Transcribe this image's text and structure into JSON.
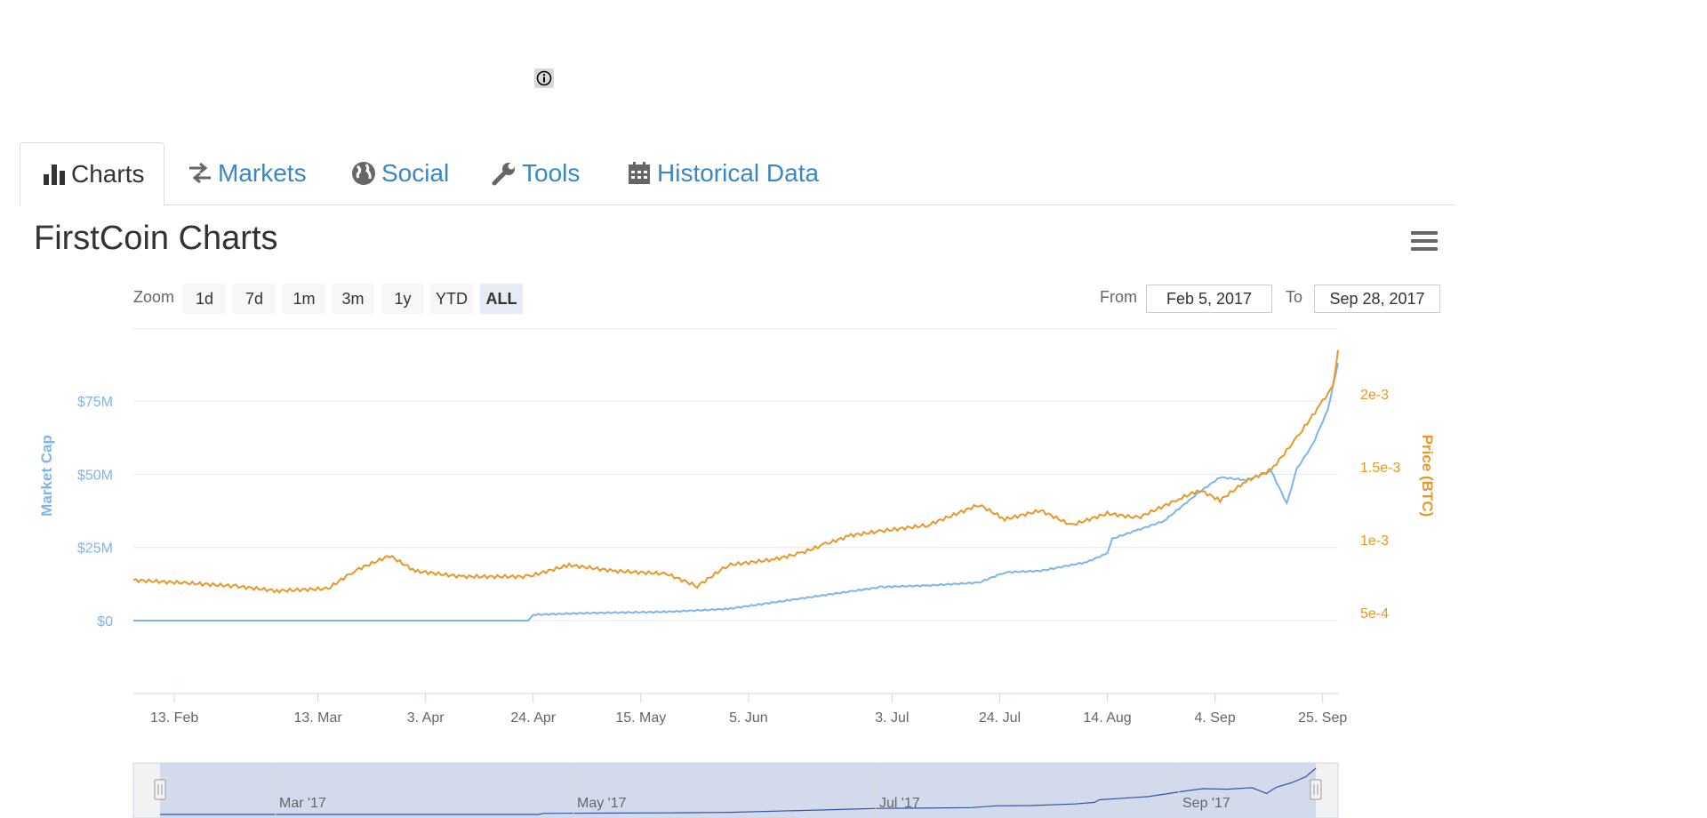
{
  "info_icon": "info-circle-icon",
  "tabs": [
    {
      "label": "Charts",
      "icon": "bar-chart-icon",
      "active": true
    },
    {
      "label": "Markets",
      "icon": "exchange-arrows-icon",
      "active": false
    },
    {
      "label": "Social",
      "icon": "globe-icon",
      "active": false
    },
    {
      "label": "Tools",
      "icon": "wrench-icon",
      "active": false
    },
    {
      "label": "Historical Data",
      "icon": "calendar-icon",
      "active": false
    }
  ],
  "colors": {
    "tab_link": "#3a87c7",
    "market_cap": "#7cb5ec",
    "price": "#e8982a",
    "navigator_fill": "#ccd6eb"
  },
  "chart_title": "FirstCoin Charts",
  "menu_icon": "hamburger-menu-icon",
  "zoom": {
    "label": "Zoom",
    "buttons": [
      "1d",
      "7d",
      "1m",
      "3m",
      "1y",
      "YTD",
      "ALL"
    ],
    "selected": "ALL"
  },
  "range": {
    "from_label": "From",
    "from_value": "Feb 5, 2017",
    "to_label": "To",
    "to_value": "Sep 28, 2017"
  },
  "chart_data": {
    "type": "line",
    "x_ticks": [
      "13. Feb",
      "13. Mar",
      "3. Apr",
      "24. Apr",
      "15. May",
      "5. Jun",
      "3. Jul",
      "24. Jul",
      "14. Aug",
      "4. Sep",
      "25. Sep"
    ],
    "y_left": {
      "label": "Market Cap",
      "ticks": [
        "$0",
        "$25M",
        "$50M",
        "$75M"
      ],
      "range": [
        0,
        100000000
      ]
    },
    "y_right": {
      "label": "Price (BTC)",
      "ticks": [
        "5e-4",
        "1e-3",
        "1.5e-3",
        "2e-3"
      ],
      "range": [
        0.0005,
        0.0025
      ]
    },
    "grid": true,
    "series": [
      {
        "axis": "left",
        "points": [
          [
            "2017-02-05",
            0
          ],
          [
            "2017-03-01",
            0
          ],
          [
            "2017-04-01",
            0
          ],
          [
            "2017-04-23",
            0
          ],
          [
            "2017-04-24",
            2000000
          ],
          [
            "2017-05-05",
            2600000
          ],
          [
            "2017-05-20",
            3000000
          ],
          [
            "2017-06-01",
            4000000
          ],
          [
            "2017-06-15",
            7500000
          ],
          [
            "2017-06-25",
            10000000
          ],
          [
            "2017-07-01",
            11500000
          ],
          [
            "2017-07-10",
            12000000
          ],
          [
            "2017-07-20",
            13000000
          ],
          [
            "2017-07-25",
            16500000
          ],
          [
            "2017-08-01",
            17000000
          ],
          [
            "2017-08-10",
            20000000
          ],
          [
            "2017-08-14",
            23000000
          ],
          [
            "2017-08-15",
            28000000
          ],
          [
            "2017-08-20",
            31000000
          ],
          [
            "2017-08-25",
            34000000
          ],
          [
            "2017-09-01",
            44000000
          ],
          [
            "2017-09-05",
            49000000
          ],
          [
            "2017-09-10",
            48000000
          ],
          [
            "2017-09-15",
            51000000
          ],
          [
            "2017-09-18",
            40000000
          ],
          [
            "2017-09-20",
            52000000
          ],
          [
            "2017-09-23",
            60000000
          ],
          [
            "2017-09-26",
            72000000
          ],
          [
            "2017-09-28",
            88000000
          ]
        ]
      },
      {
        "axis": "right",
        "points": [
          [
            "2017-02-05",
            0.000722
          ],
          [
            "2017-02-15",
            0.000704
          ],
          [
            "2017-02-25",
            0.000681
          ],
          [
            "2017-03-05",
            0.000649
          ],
          [
            "2017-03-15",
            0.000665
          ],
          [
            "2017-03-20",
            0.000785
          ],
          [
            "2017-03-27",
            0.00089
          ],
          [
            "2017-04-01",
            0.000785
          ],
          [
            "2017-04-10",
            0.000747
          ],
          [
            "2017-04-23",
            0.000747
          ],
          [
            "2017-05-01",
            0.000826
          ],
          [
            "2017-05-10",
            0.000785
          ],
          [
            "2017-05-20",
            0.000766
          ],
          [
            "2017-05-26",
            0.000681
          ],
          [
            "2017-06-01",
            0.000826
          ],
          [
            "2017-06-10",
            0.000865
          ],
          [
            "2017-06-15",
            0.000905
          ],
          [
            "2017-06-20",
            0.00097
          ],
          [
            "2017-06-25",
            0.00103
          ],
          [
            "2017-07-01",
            0.00106
          ],
          [
            "2017-07-10",
            0.0011
          ],
          [
            "2017-07-20",
            0.00124
          ],
          [
            "2017-07-25",
            0.00114
          ],
          [
            "2017-08-01",
            0.0012
          ],
          [
            "2017-08-07",
            0.0011
          ],
          [
            "2017-08-14",
            0.00118
          ],
          [
            "2017-08-20",
            0.00115
          ],
          [
            "2017-08-28",
            0.00128
          ],
          [
            "2017-09-01",
            0.00134
          ],
          [
            "2017-09-05",
            0.00127
          ],
          [
            "2017-09-10",
            0.0014
          ],
          [
            "2017-09-15",
            0.00148
          ],
          [
            "2017-09-20",
            0.0017
          ],
          [
            "2017-09-25",
            0.00195
          ],
          [
            "2017-09-27",
            0.00205
          ],
          [
            "2017-09-28",
            0.0023
          ]
        ]
      }
    ],
    "navigator": {
      "labels": [
        "Mar '17",
        "May '17",
        "Jul '17",
        "Sep '17"
      ]
    }
  }
}
